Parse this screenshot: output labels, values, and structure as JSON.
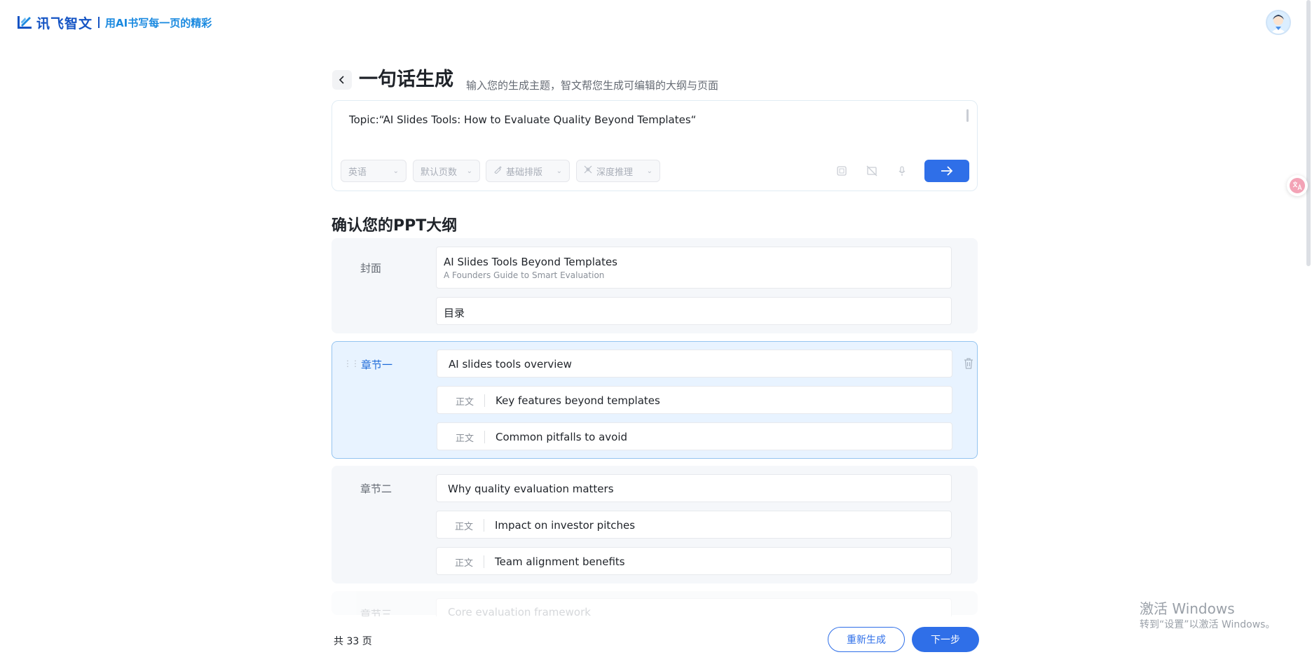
{
  "header": {
    "logo_name": "讯飞智文",
    "slogan": "用AI书写每一页的精彩"
  },
  "title_row": {
    "title": "一句话生成",
    "subtitle": "输入您的生成主题，智文帮您生成可编辑的大纲与页面"
  },
  "input": {
    "topic": "Topic:“AI Slides Tools: How to Evaluate Quality Beyond Templates“",
    "chips": [
      {
        "label": "英语"
      },
      {
        "label": "默认页数"
      },
      {
        "label": "基础排版"
      },
      {
        "label": "深度推理"
      }
    ]
  },
  "outline": {
    "heading": "确认您的PPT大纲",
    "cover": {
      "label": "封面",
      "title": "AI Slides Tools Beyond Templates",
      "subtitle": "A Founders Guide to Smart Evaluation",
      "toc": "目录"
    },
    "chapters": [
      {
        "label": "章节一",
        "title": "AI slides tools overview",
        "items": [
          {
            "kind": "正文",
            "text": "Key features beyond templates"
          },
          {
            "kind": "正文",
            "text": "Common pitfalls to avoid"
          }
        ]
      },
      {
        "label": "章节二",
        "title": "Why quality evaluation matters",
        "items": [
          {
            "kind": "正文",
            "text": "Impact on investor pitches"
          },
          {
            "kind": "正文",
            "text": "Team alignment benefits"
          }
        ]
      },
      {
        "label": "章节三",
        "title": "Core evaluation framework"
      }
    ]
  },
  "footer": {
    "page_count": "共 33 页",
    "regenerate_label": "重新生成",
    "next_label": "下一步"
  },
  "watermark": {
    "line1": "激活 Windows",
    "line2": "转到“设置”以激活 Windows。"
  },
  "colors": {
    "accent": "#2f6fe8",
    "brand": "#1554c4",
    "active_bg": "#e8f3ff",
    "active_border": "#94c4f0"
  },
  "icons": {
    "back": "chevron-left-icon",
    "send": "arrow-right-icon",
    "translate": "translate-icon",
    "trash": "trash-icon"
  }
}
